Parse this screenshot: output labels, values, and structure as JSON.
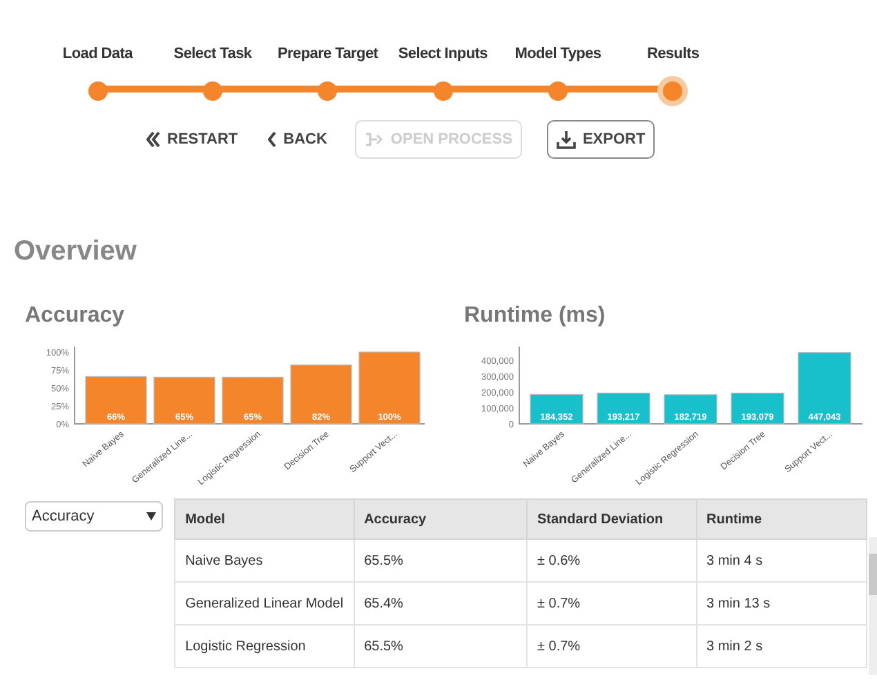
{
  "steps": [
    {
      "label": "Load Data",
      "selected": false
    },
    {
      "label": "Select Task",
      "selected": false
    },
    {
      "label": "Prepare Target",
      "selected": false
    },
    {
      "label": "Select Inputs",
      "selected": false
    },
    {
      "label": "Model Types",
      "selected": false
    },
    {
      "label": "Results",
      "selected": true
    }
  ],
  "actions": [
    {
      "kind": "restart",
      "label": "RESTART",
      "disabled": false,
      "outlined": false
    },
    {
      "kind": "back",
      "label": "BACK",
      "disabled": false,
      "outlined": false
    },
    {
      "kind": "open",
      "label": "OPEN PROCESS",
      "disabled": true,
      "outlined": true
    },
    {
      "kind": "export",
      "label": "EXPORT",
      "disabled": false,
      "outlined": true
    }
  ],
  "overview": {
    "title": "Overview",
    "charts": [
      {
        "title": "Accuracy",
        "chart_data": {
          "type": "bar",
          "categories": [
            "Naive Bayes",
            "Generalized Line...",
            "Logistic Regression",
            "Decision Tree",
            "Support Vect..."
          ],
          "ylim": [
            0,
            100
          ],
          "yticks": [
            {
              "value": 0,
              "label": "0%"
            },
            {
              "value": 25,
              "label": "25%"
            },
            {
              "value": 50,
              "label": "50%"
            },
            {
              "value": 75,
              "label": "75%"
            },
            {
              "value": 100,
              "label": "100%"
            }
          ],
          "series": [
            {
              "color": "#f5852a",
              "values": [
                66,
                65,
                65,
                82,
                100
              ]
            }
          ],
          "value_labels": [
            "66%",
            "65%",
            "65%",
            "82%",
            "100%"
          ]
        }
      },
      {
        "title": "Runtime (ms)",
        "chart_data": {
          "type": "bar",
          "categories": [
            "Naive Bayes",
            "Generalized Line...",
            "Logistic Regression",
            "Decision Tree",
            "Support Vect..."
          ],
          "ylim": [
            0,
            450000
          ],
          "yticks": [
            {
              "value": 0,
              "label": "0"
            },
            {
              "value": 100000,
              "label": "100,000"
            },
            {
              "value": 200000,
              "label": "200,000"
            },
            {
              "value": 300000,
              "label": "300,000"
            },
            {
              "value": 400000,
              "label": "400,000"
            }
          ],
          "series": [
            {
              "color": "#17c0cb",
              "values": [
                184352,
                193217,
                182719,
                193079,
                447043
              ]
            }
          ],
          "value_labels": [
            "184,352",
            "193,217",
            "182,719",
            "193,079",
            "447,043"
          ]
        }
      }
    ]
  },
  "metric_select": {
    "value": "Accuracy"
  },
  "table": {
    "columns": [
      "Model",
      "Accuracy",
      "Standard Deviation",
      "Runtime"
    ],
    "rows": [
      [
        "Naive Bayes",
        "65.5%",
        "± 0.6%",
        "3 min 4 s"
      ],
      [
        "Generalized Linear Model",
        "65.4%",
        "± 0.7%",
        "3 min 13 s"
      ],
      [
        "Logistic Regression",
        "65.5%",
        "± 0.7%",
        "3 min 2 s"
      ]
    ]
  }
}
